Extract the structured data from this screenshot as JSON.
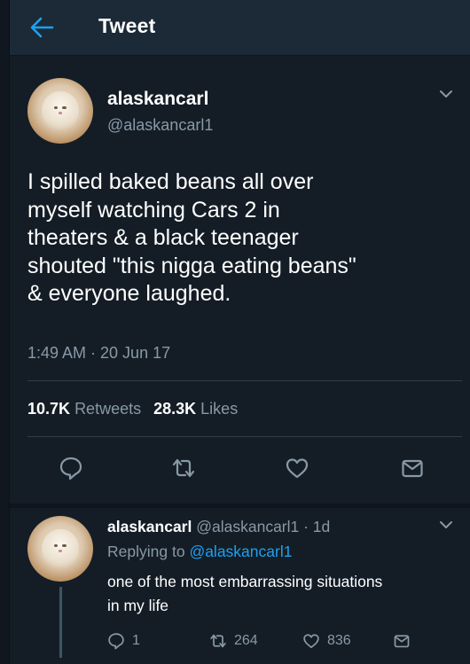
{
  "header": {
    "title": "Tweet"
  },
  "tweet": {
    "name": "alaskancarl",
    "handle": "@alaskancarl1",
    "text_lines": [
      "I spilled baked beans all over",
      "myself watching Cars 2 in",
      "theaters & a black teenager",
      "shouted \"this nigga eating beans\"",
      "& everyone laughed."
    ],
    "timestamp": "1:49 AM · 20 Jun 17",
    "retweets_count": "10.7K",
    "retweets_label": "Retweets",
    "likes_count": "28.3K",
    "likes_label": "Likes"
  },
  "reply": {
    "name": "alaskancarl",
    "handle_time": "@alaskancarl1 · 1d",
    "replying_prefix": "Replying to",
    "replying_mention": "@alaskancarl1",
    "text_lines": [
      "one of the most embarrassing situations",
      "in my life"
    ],
    "reply_count": "1",
    "retweet_count": "264",
    "like_count": "836"
  },
  "icons": {
    "back": "arrow-left-icon",
    "more": "chevron-down-icon",
    "reply": "speech-bubble-icon",
    "retweet": "retweet-icon",
    "like": "heart-icon",
    "message": "envelope-icon"
  },
  "colors": {
    "background": "#141d26",
    "header": "#1c2a38",
    "accent": "#1da1f2",
    "secondary_text": "#8899a6",
    "divider": "#2f3d4a"
  }
}
